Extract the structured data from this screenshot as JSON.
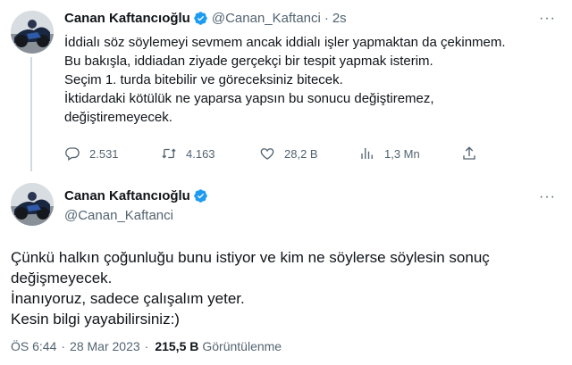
{
  "tweet": {
    "author": {
      "name": "Canan Kaftancıoğlu",
      "handle": "@Canan_Kaftanci",
      "verified_color": "#1d9bf0"
    },
    "time_ago": "2s",
    "lines": [
      "İddialı söz söylemeyi sevmem ancak iddialı işler yapmaktan da çekinmem.",
      "Bu bakışla, iddiadan ziyade gerçekçi bir tespit yapmak isterim.",
      "Seçim 1. turda bitebilir ve göreceksiniz bitecek.",
      "İktidardaki kötülük ne yaparsa yapsın bu sonucu değiştiremez,",
      "değiştiremeyecek."
    ],
    "stats": {
      "replies": "2.531",
      "retweets": "4.163",
      "likes": "28,2 B",
      "views": "1,3 Mn"
    },
    "icons": [
      "reply-icon",
      "retweet-icon",
      "like-icon",
      "views-icon",
      "share-icon",
      "more-icon",
      "verified-icon"
    ]
  },
  "reply": {
    "author": {
      "name": "Canan Kaftancıoğlu",
      "handle": "@Canan_Kaftanci"
    },
    "lines": [
      "Çünkü halkın çoğunluğu bunu istiyor ve kim ne söylerse söylesin sonuç",
      "değişmeyecek.",
      "İnanıyoruz, sadece çalışalım yeter.",
      "Kesin bilgi yayabilirsiniz:)"
    ],
    "time": "ÖS 6:44",
    "date": "28 Mar 2023",
    "views_count": "215,5 B",
    "views_label": "Görüntülenme"
  },
  "ui": {
    "dot": "·",
    "more": "···"
  }
}
